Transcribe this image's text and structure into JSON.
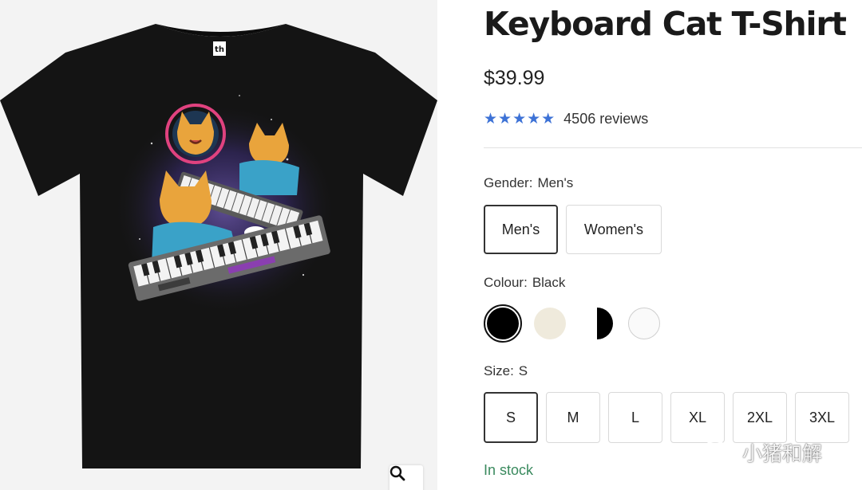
{
  "product": {
    "title": "Keyboard Cat T-Shirt",
    "price": "$39.99",
    "rating": {
      "stars": "★★★★★",
      "score": 5,
      "reviews": "4506 reviews"
    },
    "stock": "In stock"
  },
  "gallery": {
    "image_icon": "keyboard-cat-tshirt-image",
    "tag_text": "th",
    "zoom_icon": "magnifier-icon"
  },
  "gender": {
    "label": "Gender:",
    "value": "Men's",
    "options": [
      "Men's",
      "Women's"
    ],
    "selected": "Men's"
  },
  "colour": {
    "label": "Colour:",
    "value": "Black",
    "swatches": [
      {
        "name": "Black",
        "color": "#000000"
      },
      {
        "name": "Natural",
        "color": "#efeadc"
      },
      {
        "name": "Black/White",
        "color": "#000000"
      },
      {
        "name": "White",
        "color": "#fafafa"
      }
    ],
    "selected": "Black"
  },
  "size": {
    "label": "Size:",
    "value": "S",
    "options": [
      "S",
      "M",
      "L",
      "XL",
      "2XL",
      "3XL"
    ],
    "selected": "S"
  },
  "colors": {
    "accent_star": "#3d72d6",
    "stock_green": "#3a8a5e"
  },
  "watermark": {
    "text": "小猪和解",
    "icon": "wechat-icon"
  }
}
